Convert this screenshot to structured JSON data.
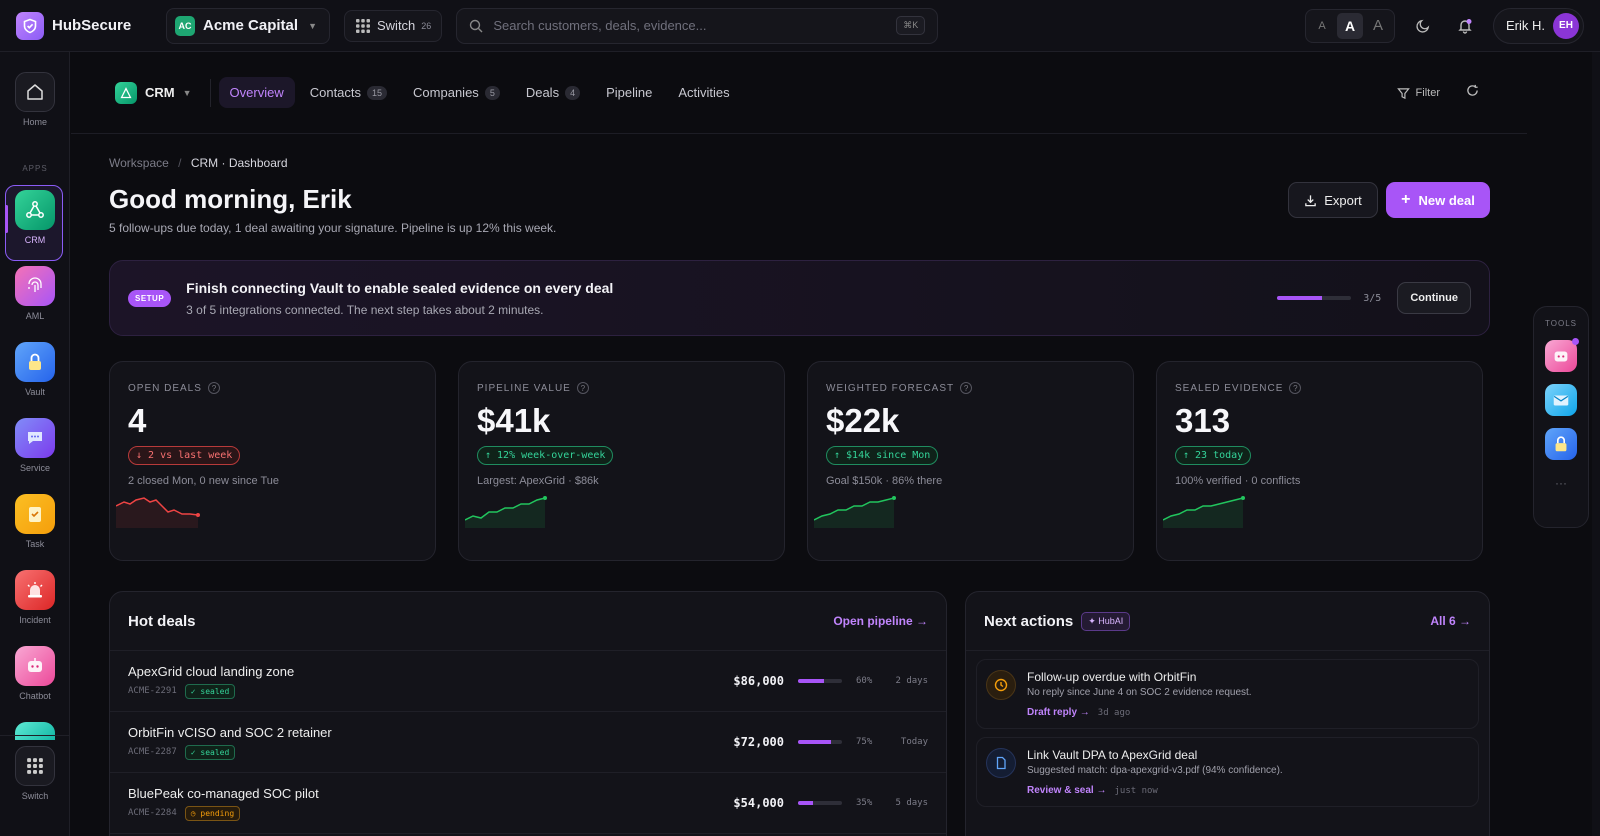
{
  "app": {
    "name": "HubSecure"
  },
  "org": {
    "badge": "AC",
    "name": "Acme Capital"
  },
  "switcher": {
    "label": "Switch",
    "count": "26"
  },
  "search": {
    "placeholder": "Search customers, deals, evidence...",
    "shortcut": "⌘K"
  },
  "font_size": {
    "small": "A",
    "medium": "A",
    "large": "A"
  },
  "user": {
    "name": "Erik H.",
    "initials": "EH"
  },
  "sidebar": {
    "home": "Home",
    "apps_header": "APPS",
    "items": [
      {
        "label": "CRM",
        "icon": "crm-icon"
      },
      {
        "label": "AML",
        "icon": "fingerprint-icon"
      },
      {
        "label": "Vault",
        "icon": "lock-icon"
      },
      {
        "label": "Service",
        "icon": "chat-bubble-icon"
      },
      {
        "label": "Task",
        "icon": "clipboard-icon"
      },
      {
        "label": "Incident",
        "icon": "siren-icon"
      },
      {
        "label": "Chatbot",
        "icon": "bot-icon"
      }
    ],
    "switch": "Switch"
  },
  "subnav": {
    "module": "CRM",
    "tabs": [
      {
        "label": "Overview",
        "count": null
      },
      {
        "label": "Contacts",
        "count": "15"
      },
      {
        "label": "Companies",
        "count": "5"
      },
      {
        "label": "Deals",
        "count": "4"
      },
      {
        "label": "Pipeline",
        "count": null
      },
      {
        "label": "Activities",
        "count": null
      }
    ],
    "filter": "Filter"
  },
  "breadcrumb": {
    "root": "Workspace",
    "sep": "/",
    "current": "CRM · Dashboard"
  },
  "header": {
    "title": "Good morning, Erik",
    "subtitle": "5 follow-ups due today, 1 deal awaiting your signature. Pipeline is up 12% this week.",
    "export": "Export",
    "new_deal": "New deal"
  },
  "setup": {
    "badge": "SETUP",
    "title": "Finish connecting Vault to enable sealed evidence on every deal",
    "desc": "3 of 5 integrations connected. The next step takes about 2 minutes.",
    "progress": "3/5",
    "progress_fraction": 0.6,
    "cta": "Continue"
  },
  "stats": [
    {
      "label": "OPEN DEALS",
      "value": "4",
      "delta": "↓ 2 vs last week",
      "trend": "down",
      "note": "2 closed Mon, 0 new since Tue",
      "color": "#ef4444"
    },
    {
      "label": "PIPELINE VALUE",
      "value": "$41k",
      "delta": "↑ 12% week-over-week",
      "trend": "up",
      "note": "Largest: ApexGrid · $86k",
      "color": "#22c55e"
    },
    {
      "label": "WEIGHTED FORECAST",
      "value": "$22k",
      "delta": "↑ $14k since Mon",
      "trend": "up",
      "note": "Goal $150k · 86% there",
      "color": "#22c55e"
    },
    {
      "label": "SEALED EVIDENCE",
      "value": "313",
      "delta": "↑ 23 today",
      "trend": "up",
      "note": "100% verified · 0 conflicts",
      "color": "#22c55e"
    }
  ],
  "hot_deals": {
    "title": "Hot deals",
    "link": "Open pipeline →",
    "rows": [
      {
        "name": "ApexGrid cloud landing zone",
        "id": "ACME-2291",
        "tag": "✓ sealed",
        "tag_type": "sealed",
        "amount": "$86,000",
        "pct": "60%",
        "progress": 0.6,
        "when": "2 days"
      },
      {
        "name": "OrbitFin vCISO and SOC 2 retainer",
        "id": "ACME-2287",
        "tag": "✓ sealed",
        "tag_type": "sealed",
        "amount": "$72,000",
        "pct": "75%",
        "progress": 0.75,
        "when": "Today"
      },
      {
        "name": "BluePeak co-managed SOC pilot",
        "id": "ACME-2284",
        "tag": "◷ pending",
        "tag_type": "pending",
        "amount": "$54,000",
        "pct": "35%",
        "progress": 0.35,
        "when": "5 days"
      }
    ]
  },
  "next_actions": {
    "title": "Next actions",
    "badge": "✦ HubAI",
    "link": "All 6 →",
    "items": [
      {
        "title": "Follow-up overdue with OrbitFin",
        "desc": "No reply since June 4 on SOC 2 evidence request.",
        "link": "Draft reply →",
        "time": "3d ago",
        "icon": "clock-icon"
      },
      {
        "title": "Link Vault DPA to ApexGrid deal",
        "desc": "Suggested match: dpa-apexgrid-v3.pdf (94% confidence).",
        "link": "Review & seal →",
        "time": "just now",
        "icon": "document-icon"
      }
    ]
  },
  "tools": {
    "label": "TOOLS",
    "more": "···"
  }
}
